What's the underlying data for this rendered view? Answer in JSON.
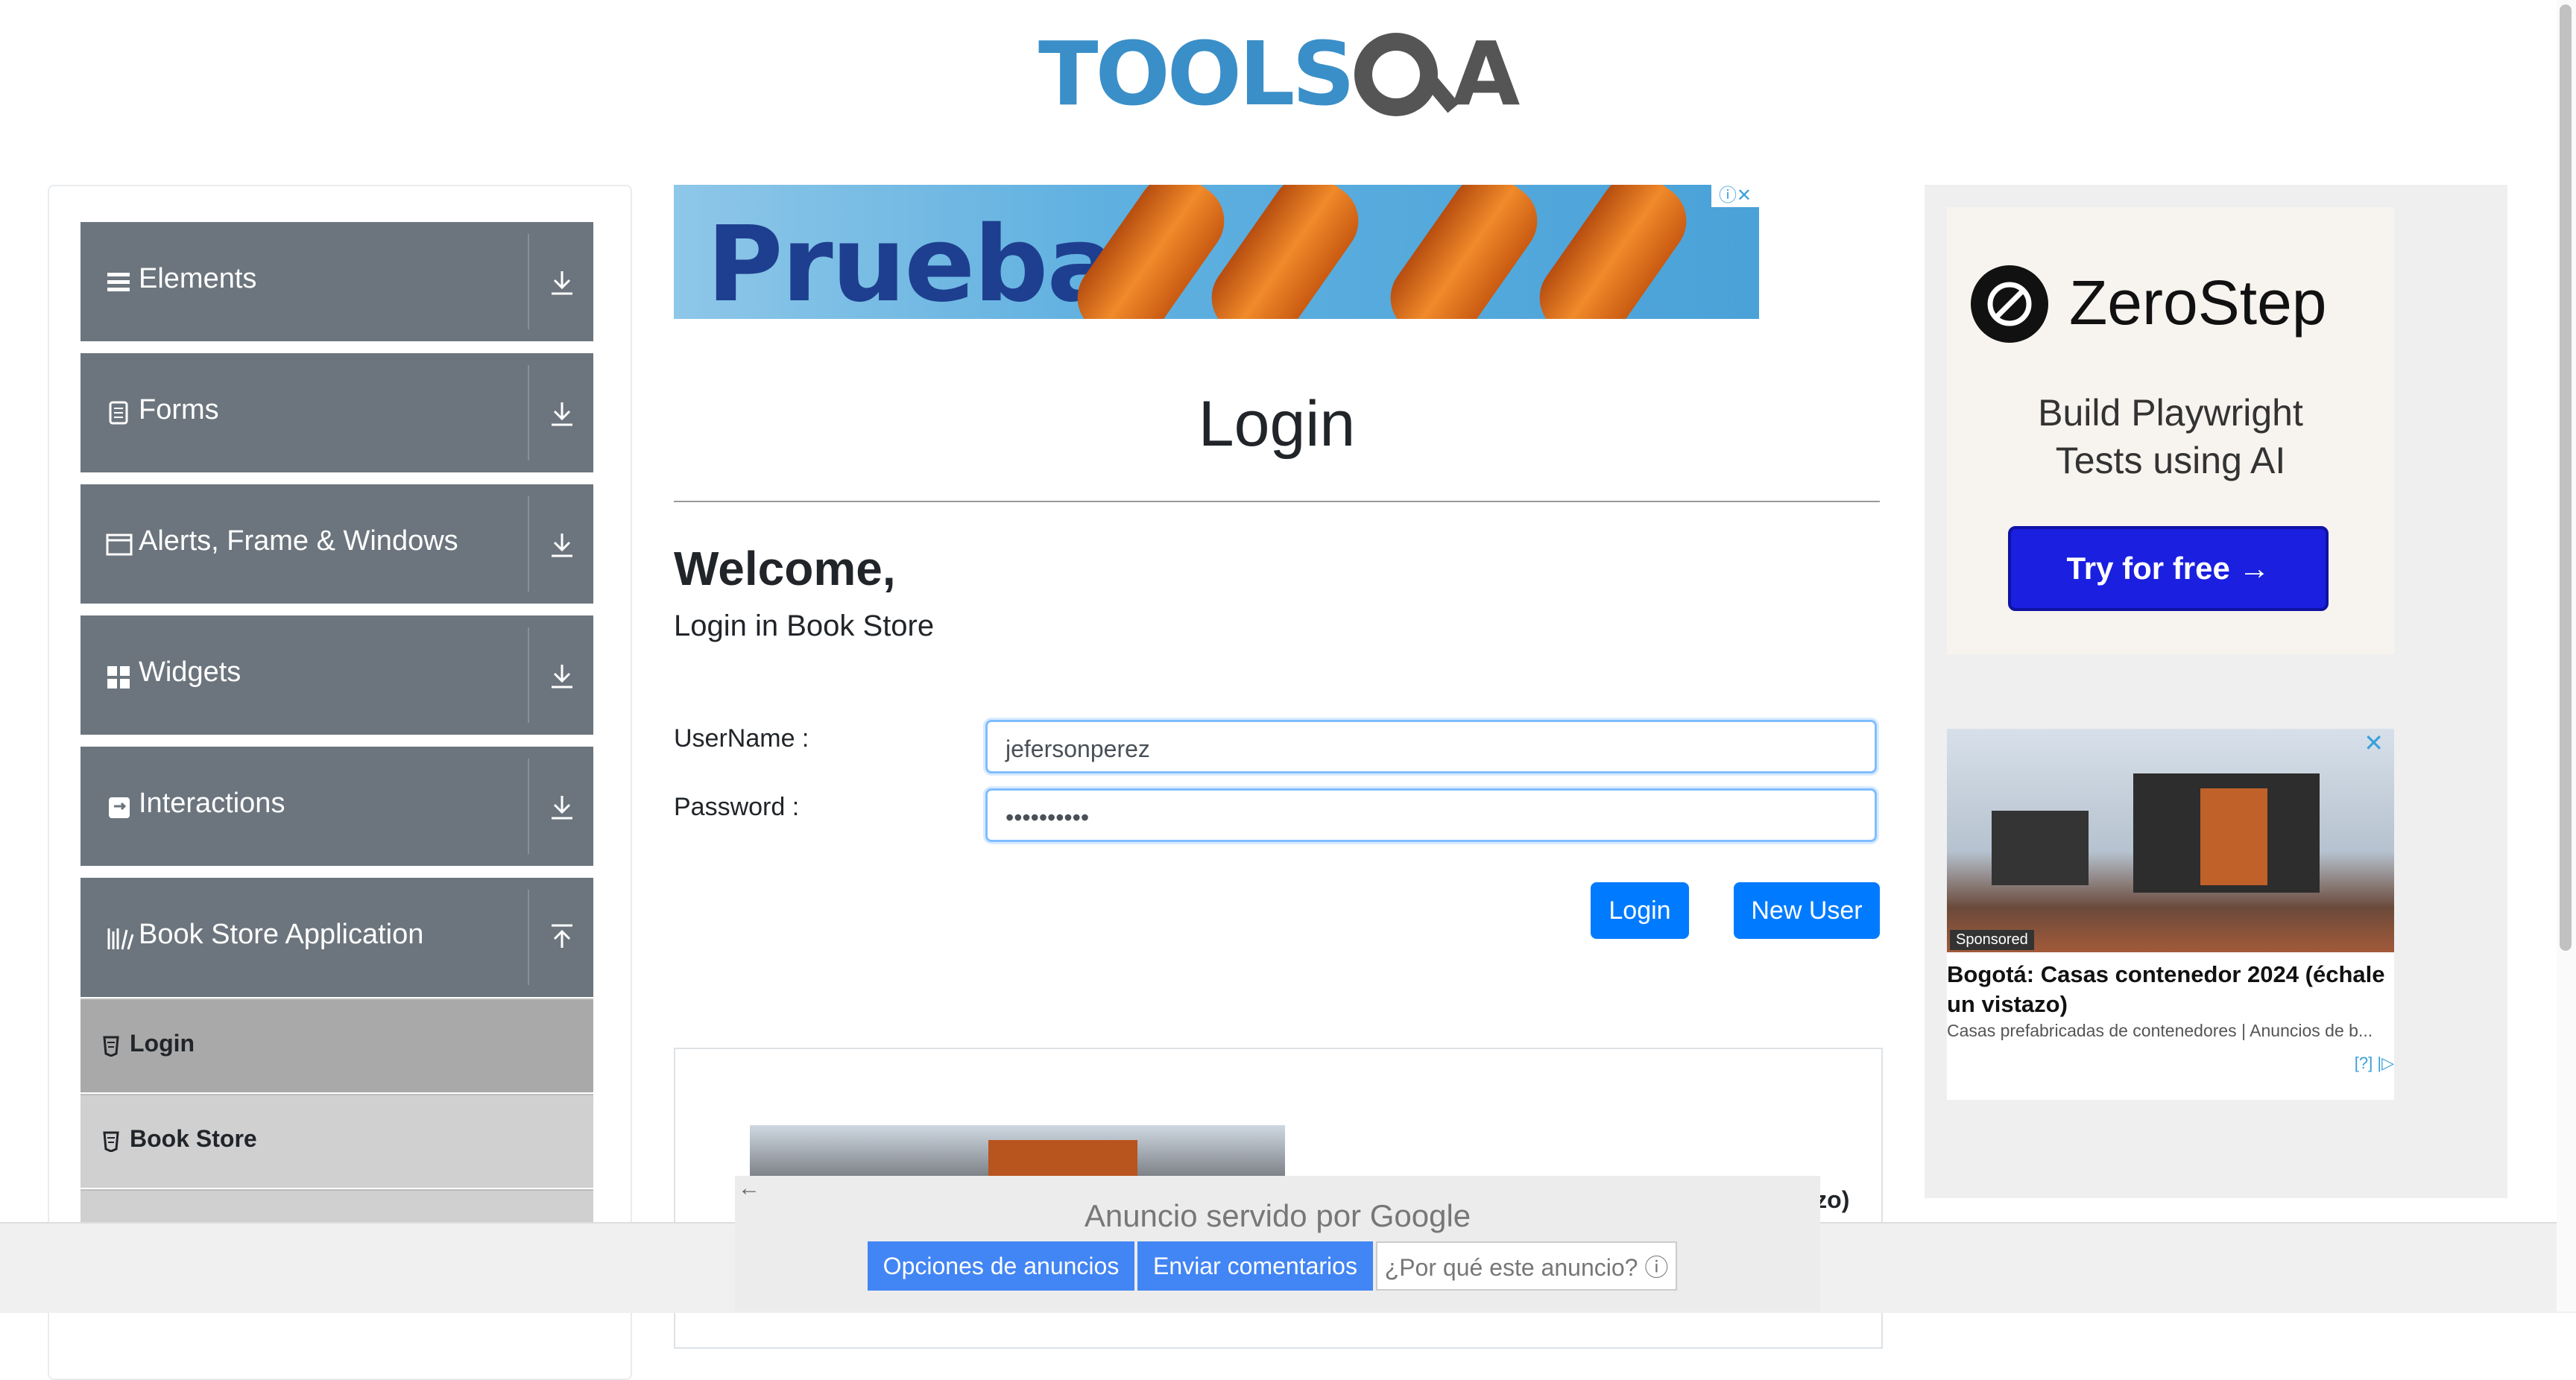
{
  "header": {
    "logo_text": "TOOLSQA"
  },
  "sidebar": {
    "groups": [
      {
        "label": "Elements",
        "icon": "hamburger-icon"
      },
      {
        "label": "Forms",
        "icon": "document-icon"
      },
      {
        "label": "Alerts, Frame & Windows",
        "icon": "window-icon"
      },
      {
        "label": "Widgets",
        "icon": "widgets-icon"
      },
      {
        "label": "Interactions",
        "icon": "interactions-icon"
      },
      {
        "label": "Book Store Application",
        "icon": "books-icon",
        "expanded": true
      }
    ],
    "book_store_items": [
      {
        "label": "Login",
        "active": true
      },
      {
        "label": "Book Store",
        "active": false
      }
    ]
  },
  "ad_top": {
    "text": "Prueba",
    "close": "ⓘ✕"
  },
  "main": {
    "title": "Login",
    "welcome": "Welcome,",
    "subtitle": "Login in Book Store",
    "username_label": "UserName :",
    "username_value": "jefersonperez",
    "password_label": "Password :",
    "password_value": "••••••••••",
    "login_button": "Login",
    "new_user_button": "New User",
    "partial_ad_text": "istazo)"
  },
  "ad_right": {
    "zerostep": {
      "name": "ZeroStep",
      "tagline_1": "Build Playwright",
      "tagline_2": "Tests using AI",
      "cta": "Try for free →"
    },
    "native": {
      "sponsored": "Sponsored",
      "close": "✕",
      "title": "Bogotá: Casas contenedor 2024 (échale un vistazo)",
      "description": "Casas prefabricadas de contenedores | Anuncios de b...",
      "footer": "[?] |▷"
    }
  },
  "google_bar": {
    "back": "←",
    "served_by": "Anuncio servido por Google",
    "options": "Opciones de anuncios",
    "feedback": "Enviar comentarios",
    "why": "¿Por qué este anuncio? ⓘ"
  },
  "colors": {
    "sidebar_group": "#6c757d",
    "primary": "#007bff",
    "ad_cta": "#1a1fe0"
  }
}
